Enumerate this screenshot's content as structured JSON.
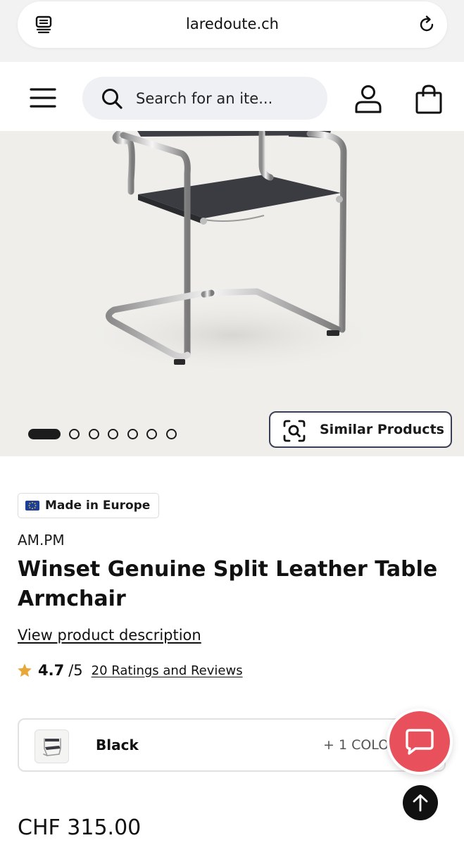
{
  "browser": {
    "url": "laredoute.ch",
    "tabs_icon": "tabs-icon",
    "reload_icon": "reload-icon"
  },
  "header": {
    "menu_icon": "hamburger-menu-icon",
    "search_placeholder": "Search for an ite...",
    "account_icon": "user-icon",
    "cart_icon": "shopping-bag-icon"
  },
  "gallery": {
    "image_count": 7,
    "active_index": 0,
    "similar_products_label": "Similar Products",
    "similar_icon": "visual-search-icon"
  },
  "product": {
    "badge": "Made in Europe",
    "badge_icon": "eu-flag-icon",
    "brand": "AM.PM",
    "title": "Winset Genuine Split Leather Table Armchair",
    "description_link": "View product description",
    "rating": "4.7",
    "rating_max": "/5",
    "reviews_link": "20 Ratings and Reviews",
    "color": "Black",
    "more_colors": "+ 1 COLOUR",
    "price": "CHF 315.00"
  },
  "floating": {
    "chat_icon": "chat-bubble-icon",
    "scroll_top_icon": "arrow-up-icon"
  },
  "colors": {
    "accent_chat": "#e8505b",
    "image_background": "#efeeeb",
    "star": "#e8a838"
  }
}
